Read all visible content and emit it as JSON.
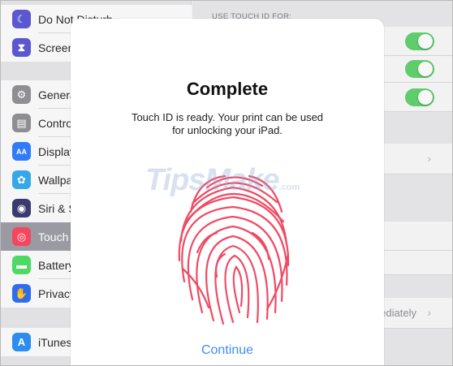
{
  "sidebar": {
    "items": [
      {
        "label": "Do Not Disturb",
        "icon": "moon-icon",
        "color": "#5a57cf",
        "glyph": "☾"
      },
      {
        "label": "Screen",
        "icon": "hourglass-icon",
        "color": "#5a57cf",
        "glyph": "⧗"
      },
      {
        "label": "Genera",
        "icon": "gear-icon",
        "color": "#8e8e93",
        "glyph": "⚙"
      },
      {
        "label": "Control",
        "icon": "switches-icon",
        "color": "#8e8e93",
        "glyph": "▤"
      },
      {
        "label": "Display",
        "icon": "display-icon",
        "color": "#2f7cf6",
        "glyph": "AA"
      },
      {
        "label": "Wallpap",
        "icon": "wallpaper-icon",
        "color": "#36a7e8",
        "glyph": "✿"
      },
      {
        "label": "Siri & S",
        "icon": "siri-icon",
        "color": "#3a3a6e",
        "glyph": "◉"
      },
      {
        "label": "Touch I",
        "icon": "fingerprint-icon",
        "color": "#f4475e",
        "glyph": "◎"
      },
      {
        "label": "Battery",
        "icon": "battery-icon",
        "color": "#4cd964",
        "glyph": "▬"
      },
      {
        "label": "Privacy",
        "icon": "hand-icon",
        "color": "#2f6cf0",
        "glyph": "✋"
      },
      {
        "label": "iTunes",
        "icon": "appstore-icon",
        "color": "#2d8cf0",
        "glyph": "A"
      }
    ]
  },
  "panel": {
    "section_header": "USE TOUCH ID FOR:",
    "passcode_value": "ediately",
    "chevron": "›"
  },
  "modal": {
    "title": "Complete",
    "subtitle_line1": "Touch ID is ready. Your print can be used",
    "subtitle_line2": "for unlocking your iPad.",
    "continue_label": "Continue",
    "fingerprint_color": "#f04a64"
  },
  "watermark": {
    "text": "TipsMake",
    "suffix": ".com"
  }
}
